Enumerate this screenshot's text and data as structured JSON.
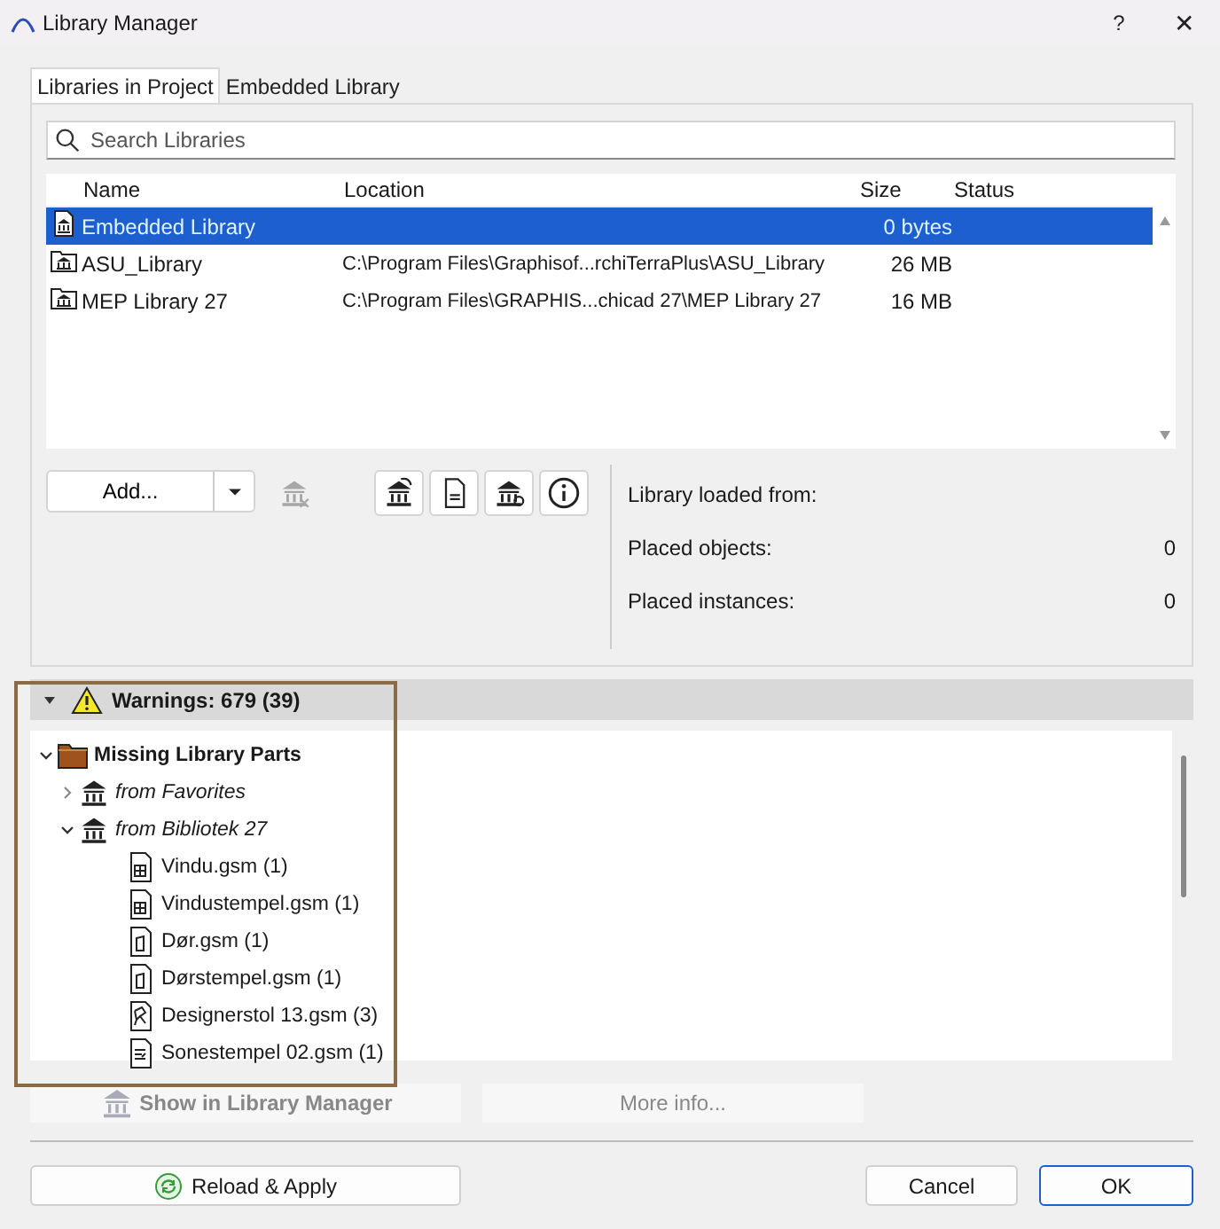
{
  "window": {
    "title": "Library Manager",
    "buttons": [
      {
        "kind": "help",
        "label": "?"
      },
      {
        "kind": "close",
        "label": "✕"
      }
    ]
  },
  "tabs": [
    {
      "label": "Libraries in Project",
      "selected": true
    },
    {
      "label": "Embedded Library",
      "selected": false
    }
  ],
  "search": {
    "placeholder": "Search Libraries"
  },
  "table": {
    "columns": [
      "Name",
      "Location",
      "Size",
      "Status"
    ],
    "rows": [
      {
        "name": "Embedded Library",
        "size": "0 bytes",
        "kind": "embedded",
        "selected": true
      },
      {
        "name": "ASU_Library",
        "location": "C:\\Program Files\\Graphisof...rchiTerraPlus\\ASU_Library",
        "size": "26 MB",
        "kind": "folder",
        "selected": false
      },
      {
        "name": "MEP Library 27",
        "location": "C:\\Program Files\\GRAPHIS...chicad 27\\MEP Library 27",
        "size": "16 MB",
        "kind": "folder",
        "selected": false
      }
    ]
  },
  "toolbar": {
    "add_button": "Add...",
    "tools": [
      {
        "kind": "remove",
        "disabled": true
      },
      {
        "kind": "reload",
        "disabled": false
      },
      {
        "kind": "document",
        "disabled": false
      },
      {
        "kind": "manage",
        "disabled": false
      },
      {
        "kind": "info",
        "disabled": false
      }
    ]
  },
  "info": [
    {
      "label": "Library loaded from:"
    },
    {
      "label": "Placed objects:",
      "value": "0"
    },
    {
      "label": "Placed instances:",
      "value": "0"
    }
  ],
  "warnings": {
    "title": "Warnings: 679 (39)",
    "expanded": true,
    "tree": [
      {
        "label": "Missing Library Parts",
        "kind": "category",
        "expanded": true,
        "children": [
          {
            "label": "from Favorites",
            "kind": "library",
            "expanded": false
          },
          {
            "label": "from Bibliotek 27",
            "kind": "library",
            "expanded": true,
            "children": [
              {
                "label": "Vindu.gsm (1)",
                "kind": "window"
              },
              {
                "label": "Vindustempel.gsm (1)",
                "kind": "window"
              },
              {
                "label": "Dør.gsm (1)",
                "kind": "door"
              },
              {
                "label": "Dørstempel.gsm (1)",
                "kind": "door"
              },
              {
                "label": "Designerstol 13.gsm (3)",
                "kind": "chair"
              },
              {
                "label": "Sonestempel 02.gsm (1)",
                "kind": "zone"
              }
            ]
          }
        ]
      }
    ]
  },
  "actions": [
    {
      "label": "Show in Library Manager",
      "kind": "show",
      "disabled": true
    },
    {
      "label": "More info...",
      "kind": "plain",
      "disabled": true
    }
  ],
  "footer": [
    {
      "label": "Reload & Apply",
      "kind": "reload",
      "default": false
    },
    {
      "label": "Cancel",
      "kind": "plain",
      "default": false
    },
    {
      "label": "OK",
      "kind": "plain",
      "default": true
    }
  ]
}
